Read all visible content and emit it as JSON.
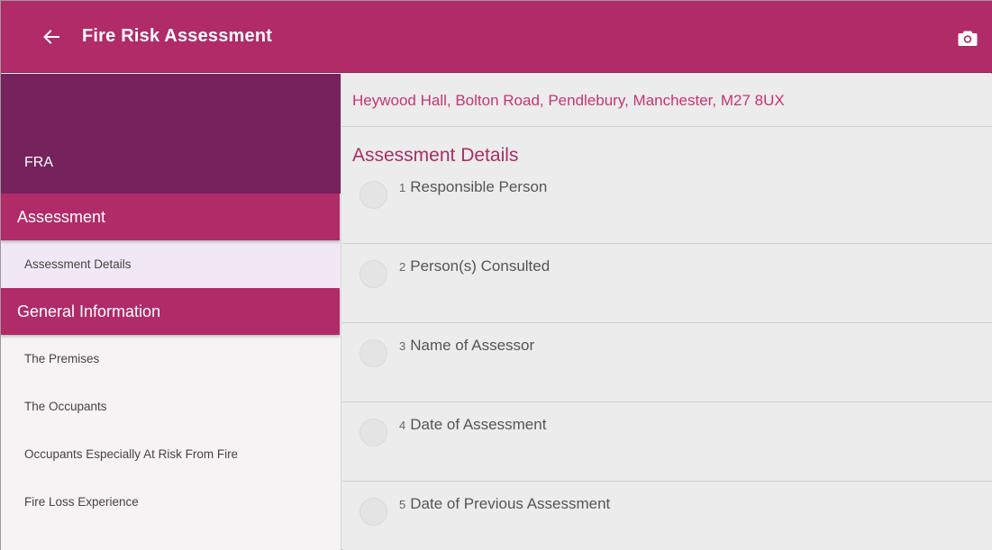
{
  "appbar": {
    "title": "Fire Risk Assessment",
    "back_icon": "arrow-left-icon",
    "camera_icon": "camera-icon",
    "color": "#b02b68"
  },
  "sidebar": {
    "header_label": "FRA",
    "header_color": "#76225d",
    "sections": [
      {
        "title": "Assessment",
        "items": [
          "Assessment Details"
        ]
      },
      {
        "title": "General Information",
        "items": [
          "The Premises",
          "The Occupants",
          "Occupants Especially At Risk From Fire",
          "Fire Loss Experience"
        ]
      }
    ],
    "active_item": "Assessment Details"
  },
  "main": {
    "address": "Heywood Hall, Bolton Road, Pendlebury, Manchester, M27 8UX",
    "section_title": "Assessment Details",
    "questions": [
      {
        "num": "1",
        "label": "Responsible Person"
      },
      {
        "num": "2",
        "label": "Person(s) Consulted"
      },
      {
        "num": "3",
        "label": "Name of Assessor"
      },
      {
        "num": "4",
        "label": "Date of Assessment"
      },
      {
        "num": "5",
        "label": "Date of Previous Assessment"
      }
    ]
  }
}
